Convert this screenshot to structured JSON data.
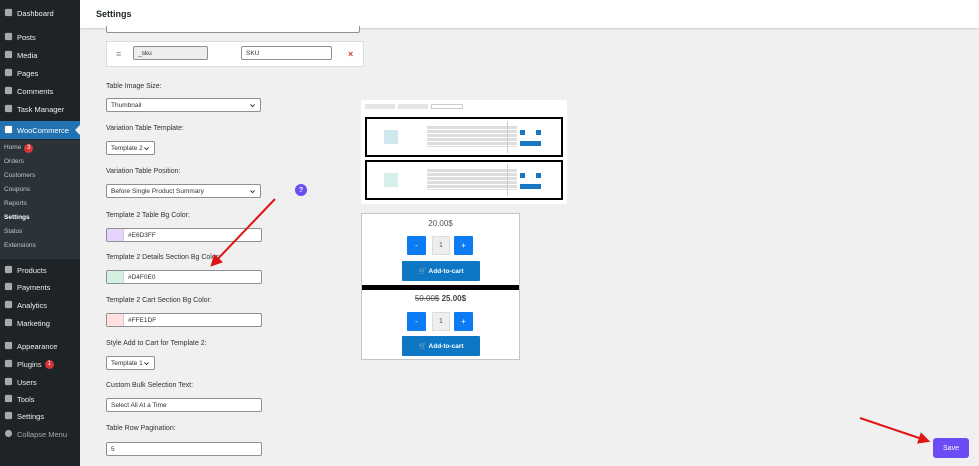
{
  "sidebar": {
    "items_top": [
      {
        "label": "Dashboard",
        "icon": "dashboard-icon"
      },
      {
        "label": "Posts",
        "icon": "pushpin-icon"
      },
      {
        "label": "Media",
        "icon": "media-icon"
      },
      {
        "label": "Pages",
        "icon": "pages-icon"
      },
      {
        "label": "Comments",
        "icon": "comment-icon"
      },
      {
        "label": "Task Manager",
        "icon": "task-icon"
      },
      {
        "label": "WooCommerce",
        "icon": "woocommerce-icon"
      }
    ],
    "submenu": [
      {
        "label": "Home",
        "badge": "3"
      },
      {
        "label": "Orders"
      },
      {
        "label": "Customers"
      },
      {
        "label": "Coupons"
      },
      {
        "label": "Reports"
      },
      {
        "label": "Settings"
      },
      {
        "label": "Status"
      },
      {
        "label": "Extensions"
      }
    ],
    "items_bottom": [
      {
        "label": "Products",
        "icon": "archive-icon"
      },
      {
        "label": "Payments",
        "icon": "dollar-icon"
      },
      {
        "label": "Analytics",
        "icon": "chart-icon"
      },
      {
        "label": "Marketing",
        "icon": "megaphone-icon"
      },
      {
        "label": "Appearance",
        "icon": "brush-icon"
      },
      {
        "label": "Plugins",
        "icon": "plugin-icon",
        "badge": "1"
      },
      {
        "label": "Users",
        "icon": "users-icon"
      },
      {
        "label": "Tools",
        "icon": "wrench-icon"
      },
      {
        "label": "Settings",
        "icon": "settings-icon"
      },
      {
        "label": "Collapse Menu",
        "icon": "collapse-icon"
      }
    ]
  },
  "header": {
    "title": "Settings"
  },
  "form": {
    "sku_row": {
      "key": "_sku",
      "label": "SKU"
    },
    "image_size": {
      "label": "Table Image Size:",
      "value": "Thumbnail"
    },
    "variation_template": {
      "label": "Variation Table Template:",
      "value": "Template 2"
    },
    "table_position": {
      "label": "Variation Table Position:",
      "value": "Before Single Product Summary"
    },
    "bg_color": {
      "label": "Template 2 Table Bg Color:",
      "value": "#E6D3FF",
      "swatch": "#E6D3FF"
    },
    "details_bg": {
      "label": "Template 2 Details Section Bg Color:",
      "value": "#D4F0E0",
      "swatch": "#D4F0E0"
    },
    "cart_bg": {
      "label": "Template 2 Cart Section Bg Color:",
      "value": "#FFE1DF",
      "swatch": "#FFE1DF"
    },
    "atc_style": {
      "label": "Style Add to Cart for Template 2:",
      "value": "Template 1"
    },
    "bulk_text": {
      "label": "Custom Bulk Selection Text:",
      "value": "Select All At a Time"
    },
    "pagination": {
      "label": "Table Row Pagination:",
      "value": "5"
    }
  },
  "preview": {
    "price1": "20.00$",
    "price2_old": "50.00$",
    "price2_new": "25.00$",
    "qty": "1",
    "minus": "-",
    "plus": "+",
    "atc_label": "Add-to-cart"
  },
  "help_label": "?",
  "save_label": "Save",
  "colors": {
    "accent": "#6c4cf4",
    "wp_blue": "#2271b1",
    "red_arrow": "#e01414"
  }
}
